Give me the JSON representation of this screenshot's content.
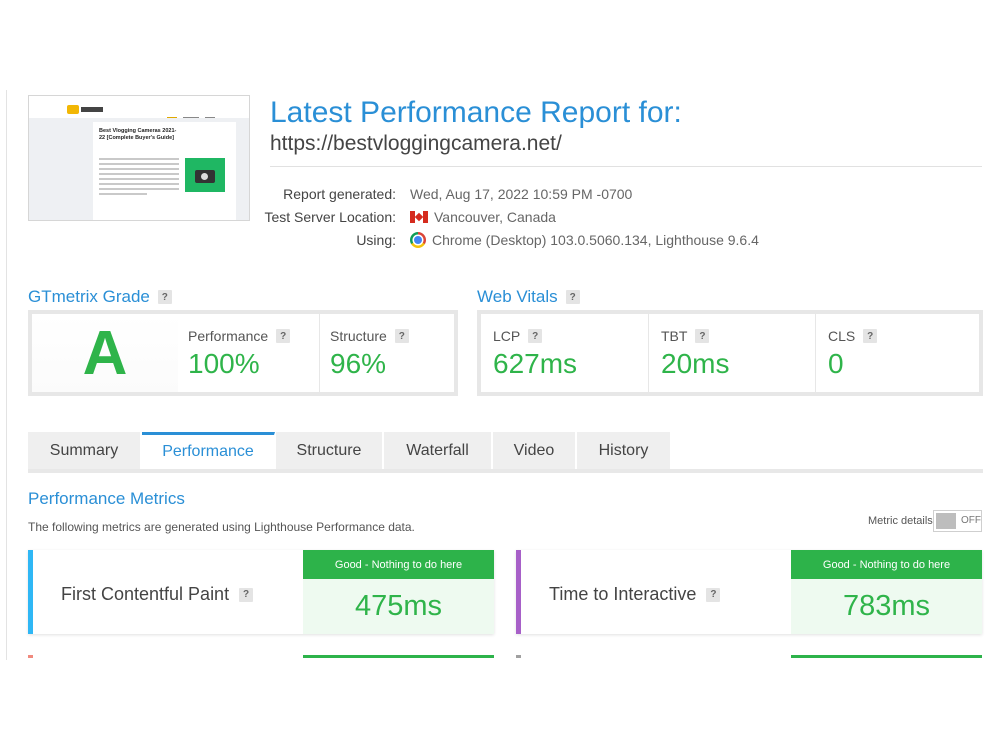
{
  "thumbnail": {
    "title": "Best Vlogging Cameras 2021- 22 [Complete Buyer's Guide]"
  },
  "header": {
    "title": "Latest Performance Report for:",
    "url": "https://bestvloggingcamera.net/"
  },
  "meta": {
    "generated_label": "Report generated:",
    "generated_value": "Wed, Aug 17, 2022 10:59 PM -0700",
    "location_label": "Test Server Location:",
    "location_value": "Vancouver, Canada",
    "using_label": "Using:",
    "using_value": "Chrome (Desktop) 103.0.5060.134, Lighthouse 9.6.4"
  },
  "grade": {
    "heading": "GTmetrix Grade",
    "letter": "A",
    "performance_label": "Performance",
    "performance_value": "100%",
    "structure_label": "Structure",
    "structure_value": "96%"
  },
  "vitals": {
    "heading": "Web Vitals",
    "lcp_label": "LCP",
    "lcp_value": "627ms",
    "tbt_label": "TBT",
    "tbt_value": "20ms",
    "cls_label": "CLS",
    "cls_value": "0"
  },
  "tabs": [
    {
      "label": "Summary"
    },
    {
      "label": "Performance"
    },
    {
      "label": "Structure"
    },
    {
      "label": "Waterfall"
    },
    {
      "label": "Video"
    },
    {
      "label": "History"
    }
  ],
  "active_tab": "Performance",
  "metrics_section": {
    "title": "Performance Metrics",
    "description": "The following metrics are generated using Lighthouse Performance data.",
    "details_label": "Metric details",
    "toggle_state": "OFF"
  },
  "metrics": [
    {
      "name": "First Contentful Paint",
      "badge": "Good - Nothing to do here",
      "value": "475ms",
      "accent": "#2fb7f5"
    },
    {
      "name": "Time to Interactive",
      "badge": "Good - Nothing to do here",
      "value": "783ms",
      "accent": "#a760c8"
    }
  ],
  "colors": {
    "brand_blue": "#2a8fd6",
    "good_green": "#2fb44a"
  }
}
